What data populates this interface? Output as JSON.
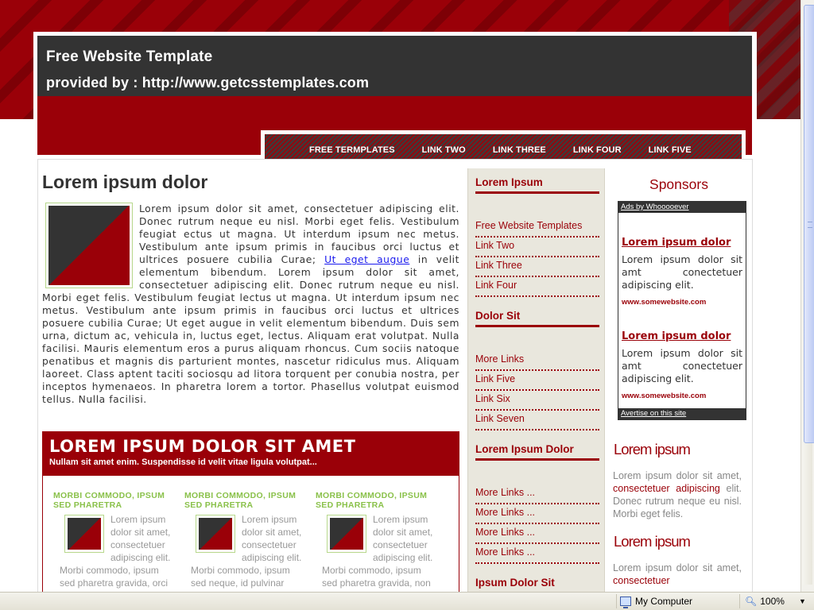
{
  "header": {
    "title_line1": "Free Website Template",
    "title_line2": "provided by : http://www.getcsstemplates.com"
  },
  "nav": {
    "items": [
      "FREE TERMPLATES",
      "LINK TWO",
      "LINK THREE",
      "LINK FOUR",
      "LINK FIVE"
    ]
  },
  "main": {
    "heading": "Lorem ipsum dolor",
    "text_part1": "Lorem ipsum dolor sit amet, consectetuer adipiscing elit. Donec rutrum neque eu nisl. Morbi eget felis. Vestibulum feugiat ectus ut magna. Ut interdum ipsum nec metus. Vestibulum ante ipsum primis in faucibus orci luctus et ultrices posuere cubilia Curae; ",
    "link_text": "Ut eget augue",
    "text_part2": " in velit elementum bibendum. Lorem ipsum dolor sit amet, consectetuer adipiscing elit. Donec rutrum neque eu nisl. Morbi eget felis. Vestibulum feugiat lectus ut magna. Ut interdum ipsum nec metus. Vestibulum ante ipsum primis in faucibus orci luctus et ultrices posuere cubilia Curae; Ut eget augue in velit elementum bibendum. Duis sem urna, dictum ac, vehicula in, luctus eget, lectus. Aliquam erat volutpat. Nulla facilisi. Mauris elementum eros a purus aliquam rhoncus. Cum sociis natoque penatibus et magnis dis parturient montes, nascetur ridiculus mus. Aliquam laoreet. Class aptent taciti sociosqu ad litora torquent per conubia nostra, per inceptos hymenaeos. In pharetra lorem a tortor. Phasellus volutpat euismod tellus. Nulla facilisi."
  },
  "promo": {
    "title": "LOREM IPSUM DOLOR SIT AMET",
    "subtitle": "Nullam sit amet enim. Suspendisse id velit vitae ligula volutpat...",
    "columns": [
      {
        "title": "MORBI COMMODO, IPSUM SED PHARETRA",
        "text": "Lorem ipsum dolor sit amet, consectetuer adipiscing elit. Morbi commodo, ipsum sed pharetra gravida, orci"
      },
      {
        "title": "MORBI COMMODO, IPSUM SED PHARETRA",
        "text": "Lorem ipsum dolor sit amet, consectetuer adipiscing elit. Morbi commodo, ipsum sed neque, id pulvinar odio"
      },
      {
        "title": "MORBI COMMODO, IPSUM SED PHARETRA",
        "text": "Lorem ipsum dolor sit amet, consectetuer adipiscing elit. Morbi commodo, ipsum sed pharetra gravida, non"
      }
    ]
  },
  "sidebar": {
    "groups": [
      {
        "heading": "Lorem Ipsum",
        "links": [
          "Free Website Templates",
          "Link Two",
          "Link Three",
          "Link Four"
        ]
      },
      {
        "heading": "Dolor Sit",
        "links": [
          "More Links",
          "Link Five",
          "Link Six",
          "Link Seven"
        ]
      },
      {
        "heading": "Lorem Ipsum Dolor",
        "links": [
          "More Links ...",
          "More Links ...",
          "More Links ...",
          "More Links ..."
        ]
      },
      {
        "heading": "Ipsum Dolor Sit",
        "links": []
      }
    ]
  },
  "right": {
    "sponsors_title": "Sponsors",
    "ads_by": "Ads by Whooooever",
    "ads": [
      {
        "title": "Lorem ipsum dolor",
        "text": "Lorem ipsum dolor sit amt conectetuer adipiscing elit.",
        "url": "www.somewebsite.com"
      },
      {
        "title": "Lorem ipsum dolor",
        "text": "Lorem ipsum dolor sit amt conectetuer adipiscing elit.",
        "url": "www.somewebsite.com"
      }
    ],
    "advertise": "Avertise on this site",
    "blocks": [
      {
        "heading": "Lorem ipsum",
        "pre": "Lorem ipsum dolor sit amet, ",
        "highlight": "consectetuer adipiscing",
        "post": " elit. Donec rutrum neque eu nisl. Morbi eget felis."
      },
      {
        "heading": "Lorem ipsum",
        "pre": "Lorem ipsum dolor sit amet, ",
        "highlight": "consectetuer",
        "post": ""
      }
    ]
  },
  "statusbar": {
    "zone": "My Computer",
    "zoom": "100%"
  },
  "colors": {
    "brand_red": "#9a0008",
    "dark_gray": "#333333",
    "accent_green": "#8ac14a",
    "sidebar_bg": "#e9e7dd"
  },
  "icons": {
    "zone": "computer-icon",
    "zoom": "zoom-icon"
  }
}
